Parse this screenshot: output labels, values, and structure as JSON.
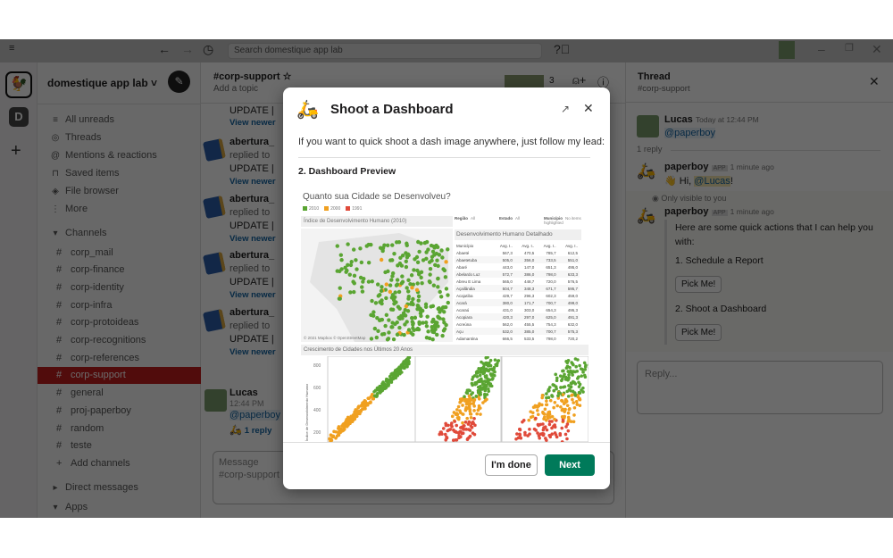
{
  "titlebar": {
    "search_placeholder": "Search domestique app lab"
  },
  "workspace": {
    "name": "domestique app lab",
    "initial": "D"
  },
  "sidebar": {
    "nav": [
      {
        "icon": "all-unreads-icon",
        "glyph": "≡",
        "label": "All unreads"
      },
      {
        "icon": "threads-icon",
        "glyph": "◎",
        "label": "Threads"
      },
      {
        "icon": "mention-icon",
        "glyph": "@",
        "label": "Mentions & reactions"
      },
      {
        "icon": "bookmark-icon",
        "glyph": "⊓",
        "label": "Saved items"
      },
      {
        "icon": "layers-icon",
        "glyph": "◈",
        "label": "File browser"
      },
      {
        "icon": "more-icon",
        "glyph": "⋮",
        "label": "More"
      }
    ],
    "channels_label": "Channels",
    "channels": [
      "corp_mail",
      "corp-finance",
      "corp-identity",
      "corp-infra",
      "corp-protoideas",
      "corp-recognitions",
      "corp-references",
      "corp-support",
      "general",
      "proj-paperboy",
      "random",
      "teste"
    ],
    "active_channel": "corp-support",
    "add_channels": "Add channels",
    "direct_messages": "Direct messages",
    "apps": "Apps",
    "active_color": "#c21d1d"
  },
  "channel": {
    "name": "#corp-support",
    "topic": "Add a topic",
    "member_count": "3",
    "top_update": "UPDATE |",
    "top_view_newer": "View newer",
    "messages": [
      {
        "author": "abertura_",
        "action": "replied to",
        "text": "UPDATE |",
        "link": "View newer"
      },
      {
        "author": "abertura_",
        "action": "replied to",
        "text": "UPDATE |",
        "link": "View newer"
      },
      {
        "author": "abertura_",
        "action": "replied to",
        "text": "UPDATE |",
        "link": "View newer"
      },
      {
        "author": "abertura_",
        "action": "replied to",
        "text": "UPDATE |",
        "link": "View newer"
      }
    ],
    "lucas": {
      "author": "Lucas",
      "time": "12:44 PM",
      "mention": "@paperboy",
      "replies": "1 reply"
    },
    "input_placeholder": "Message #corp-support"
  },
  "thread": {
    "title": "Thread",
    "channel": "#corp-support",
    "parent": {
      "author": "Lucas",
      "time": "Today at 12:44 PM",
      "mention": "@paperboy"
    },
    "reply_count": "1 reply",
    "bot1": {
      "author": "paperboy",
      "badge": "APP",
      "time": "1 minute ago",
      "greeting": "Hi,",
      "mention": "@Lucas",
      "suffix": "!"
    },
    "visibility": "Only visible to you",
    "bot2": {
      "author": "paperboy",
      "badge": "APP",
      "time": "1 minute ago",
      "intro": "Here are some quick actions that I can help you with:",
      "action1": "1. Schedule a Report",
      "button1": "Pick Me!",
      "action2": "2. Shoot a Dashboard",
      "button2": "Pick Me!"
    },
    "reply_placeholder": "Reply..."
  },
  "modal": {
    "title": "Shoot a Dashboard",
    "intro": "If you want to quick shoot a dash image anywhere, just follow my lead:",
    "section": "2. Dashboard Preview",
    "done_label": "I'm done",
    "next_label": "Next",
    "next_color": "#007a5a",
    "preview": {
      "title": "Quanto sua Cidade se Desenvolveu?",
      "legend": [
        {
          "label": "2010",
          "color": "#5aa532"
        },
        {
          "label": "2000",
          "color": "#f0a020"
        },
        {
          "label": "1991",
          "color": "#e04a3a"
        }
      ],
      "map_title": "Índice de Desenvolvimento Humano (2010)",
      "map_credit": "© 2021 Mapbox © OpenStreetMap",
      "filters": [
        {
          "label": "Região",
          "value": "All"
        },
        {
          "label": "Estado",
          "value": "All"
        },
        {
          "label": "Município",
          "value": "No items highlighted"
        }
      ],
      "table_title": "Desenvolvimento Humano Detalhado",
      "table_headers": [
        "Município",
        "Avg. I..",
        "Avg. I..",
        "Avg. I..",
        "Avg. I.."
      ],
      "table_rows": [
        [
          "Abaeté",
          "567,3",
          "470,5",
          "785,7",
          "612,5"
        ],
        [
          "Abaetetuba",
          "505,0",
          "356,0",
          "733,5",
          "551,0"
        ],
        [
          "Abaré",
          "443,0",
          "147,0",
          "651,3",
          "495,0"
        ],
        [
          "Abelardo Luz",
          "572,7",
          "386,0",
          "798,0",
          "633,3"
        ],
        [
          "Abreu E Lima",
          "565,0",
          "448,7",
          "720,0",
          "576,5"
        ],
        [
          "Açailândia",
          "504,7",
          "348,3",
          "671,7",
          "595,7"
        ],
        [
          "Acajutiba",
          "429,7",
          "296,3",
          "602,3",
          "459,0"
        ],
        [
          "Acará",
          "380,0",
          "171,7",
          "700,7",
          "499,0"
        ],
        [
          "Acaraú",
          "431,0",
          "303,0",
          "654,3",
          "495,3"
        ],
        [
          "Acopiara",
          "420,3",
          "297,0",
          "625,0",
          "491,3"
        ],
        [
          "Acreúna",
          "562,0",
          "455,5",
          "754,3",
          "632,0"
        ],
        [
          "Açu",
          "532,0",
          "385,0",
          "700,7",
          "575,3"
        ],
        [
          "Adamantina",
          "666,5",
          "533,5",
          "798,0",
          "720,2"
        ]
      ],
      "scatter_title": "Crescimento de Cidades nos Últimos 20 Anos",
      "scatter_ylabel": "Índice de Desenvolvimento Humano",
      "scatter_yticks": [
        "800",
        "600",
        "400",
        "200"
      ]
    }
  }
}
